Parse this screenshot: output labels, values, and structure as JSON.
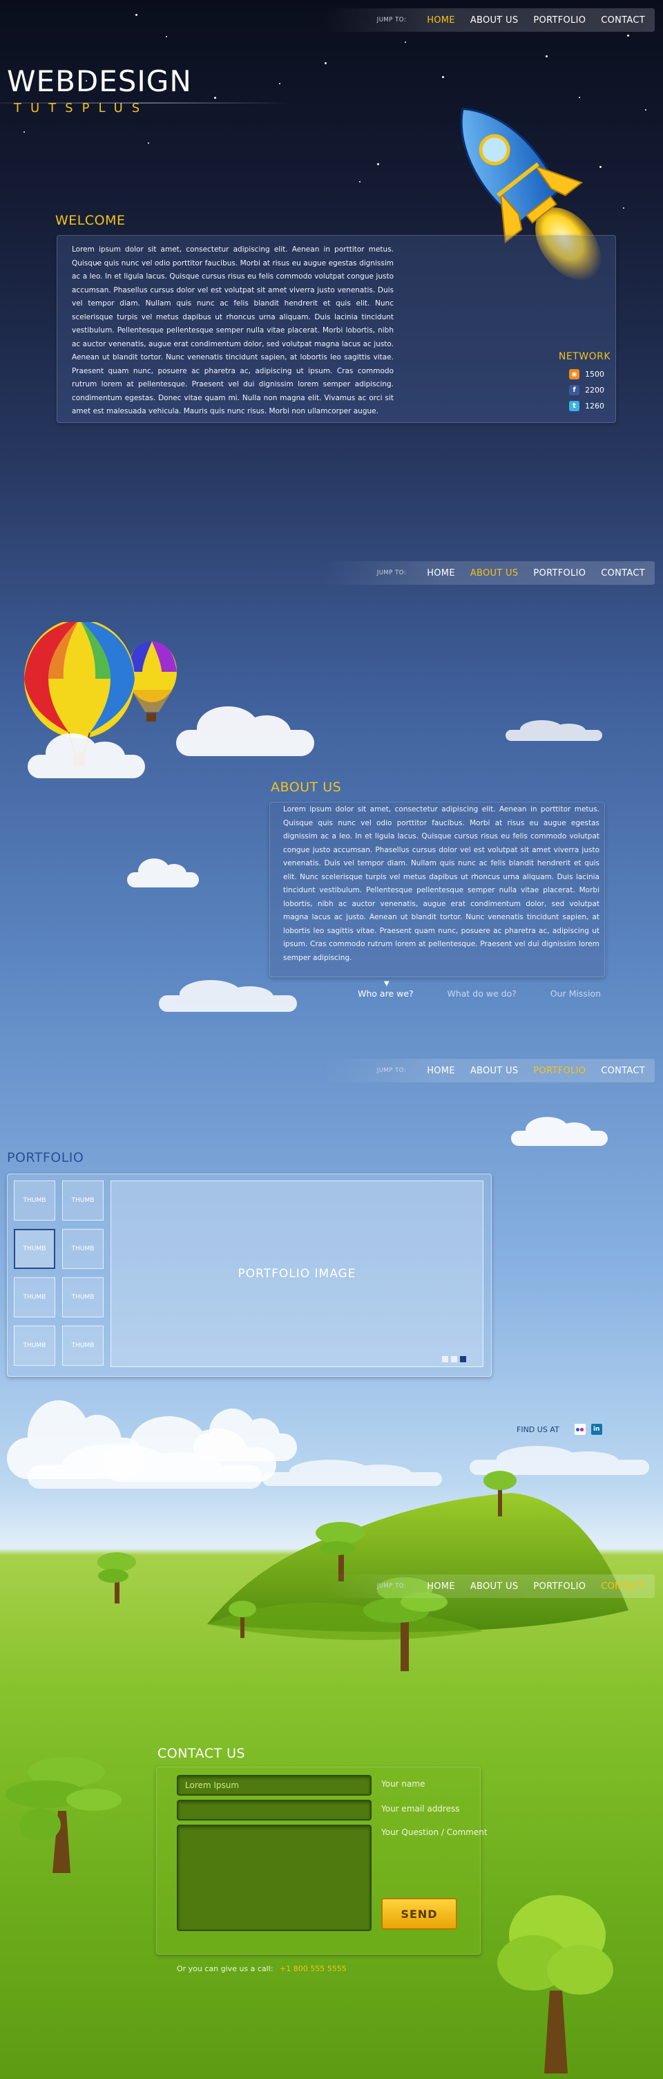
{
  "nav": {
    "jump_label": "JUMP TO:",
    "home": "HOME",
    "about": "ABOUT US",
    "portfolio": "PORTFOLIO",
    "contact": "CONTACT"
  },
  "brand": {
    "title": "WEBDESIGN",
    "subtitle": "TUTSPLUS"
  },
  "welcome": {
    "heading": "WELCOME",
    "text": "Lorem ipsum dolor sit amet, consectetur adipiscing elit. Aenean in porttitor metus. Quisque quis nunc vel odio porttitor faucibus. Morbi at risus eu augue egestas dignissim ac a leo. In et ligula lacus. Quisque cursus risus eu felis commodo volutpat congue justo accumsan. Phasellus cursus dolor vel est volutpat sit amet viverra justo venenatis. Duis vel tempor diam. Nullam quis nunc ac felis blandit hendrerit et quis elit. Nunc scelerisque turpis vel metus dapibus ut rhoncus urna aliquam. Duis lacinia tincidunt vestibulum. Pellentesque pellentesque semper nulla vitae placerat. Morbi lobortis, nibh ac auctor venenatis, augue erat condimentum dolor, sed volutpat magna lacus ac justo. Aenean ut blandit tortor. Nunc venenatis tincidunt sapien, at lobortis leo sagittis vitae. Praesent quam nunc, posuere ac pharetra ac, adipiscing ut ipsum. Cras commodo rutrum lorem at pellentesque. Praesent vel dui dignissim lorem semper adipiscing. condimentum egestas. Donec vitae quam mi. Nulla non magna elit. Vivamus ac orci sit amet est malesuada vehicula. Mauris quis nunc risus. Morbi non ullamcorper augue."
  },
  "network": {
    "heading": "NETWORK",
    "items": [
      {
        "icon": "rss-icon",
        "count": "1500",
        "color": "#f08a1c"
      },
      {
        "icon": "facebook-icon",
        "count": "2200",
        "color": "#3b5998"
      },
      {
        "icon": "twitter-icon",
        "count": "1260",
        "color": "#3cb1e6"
      }
    ]
  },
  "about": {
    "heading": "ABOUT US",
    "text": "Lorem ipsum dolor sit amet, consectetur adipiscing elit. Aenean in porttitor metus. Quisque quis nunc vel odio porttitor faucibus. Morbi at risus eu augue egestas dignissim ac a leo. In et ligula lacus. Quisque cursus risus eu felis commodo volutpat congue justo accumsan. Phasellus cursus dolor vel est volutpat sit amet viverra justo venenatis. Duis vel tempor diam. Nullam quis nunc ac felis blandit hendrerit et quis elit. Nunc scelerisque turpis vel metus dapibus ut rhoncus urna aliquam. Duis lacinia tincidunt vestibulum. Pellentesque pellentesque semper nulla vitae placerat. Morbi lobortis, nibh ac auctor venenatis, augue erat condimentum dolor, sed volutpat magna lacus ac justo. Aenean ut blandit tortor. Nunc venenatis tincidunt sapien, at lobortis leo sagittis vitae. Praesent quam nunc, posuere ac pharetra ac, adipiscing ut ipsum. Cras commodo rutrum lorem at pellentesque. Praesent vel dui dignissim lorem semper adipiscing.",
    "tabs": [
      "Who are we?",
      "What do we do?",
      "Our Mission"
    ]
  },
  "portfolio": {
    "heading": "PORTFOLIO",
    "thumb_label": "THUMB",
    "image_label": "PORTFOLIO IMAGE",
    "find_us": "FIND US AT"
  },
  "contact": {
    "heading": "CONTACT US",
    "name_value": "Lorem Ipsum",
    "name_label": "Your name",
    "email_label": "Your email address",
    "question_label": "Your Question / Comment",
    "send": "SEND",
    "call_text": "Or you can give us a call:",
    "phone": "+1 800 555 5555"
  },
  "colors": {
    "accent": "#f2c31b",
    "grass": "#7cbb22"
  }
}
